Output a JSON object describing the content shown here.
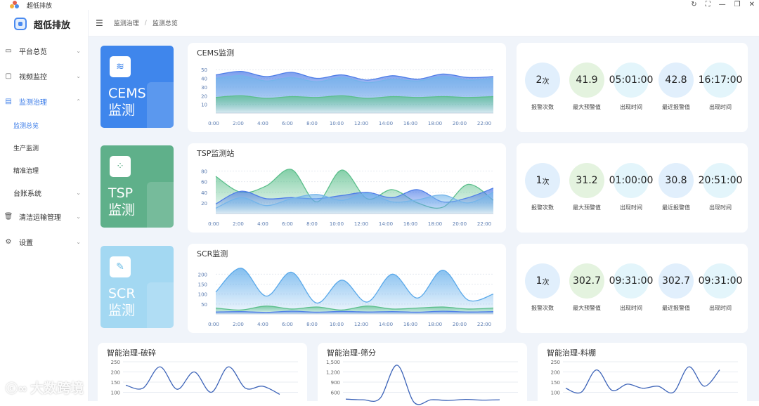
{
  "window": {
    "title": "超低排放"
  },
  "sidebar": {
    "brand": "超低排放",
    "items": [
      {
        "label": "平台总览",
        "icon": "monitor-icon"
      },
      {
        "label": "视频监控",
        "icon": "tv-icon"
      },
      {
        "label": "监测治理",
        "icon": "calendar-icon"
      },
      {
        "label": "清洁运输管理",
        "icon": "trash-icon"
      },
      {
        "label": "设置",
        "icon": "gear-icon"
      }
    ],
    "sub_items": [
      "监测总览",
      "生产监测",
      "精准治理"
    ],
    "sub_group": "台账系统"
  },
  "breadcrumb": [
    "监测治理",
    "监测总览"
  ],
  "rows": [
    {
      "hero": {
        "line1": "CEMS",
        "line2": "监测",
        "color": "#3f86ec"
      },
      "chart_title": "CEMS监测",
      "stats": [
        {
          "value": "2",
          "unit": "次",
          "label": "报警次数"
        },
        {
          "value": "41.9",
          "label": "最大预警值"
        },
        {
          "value": "05:01:00",
          "label": "出现时间"
        },
        {
          "value": "42.8",
          "label": "最近报警值"
        },
        {
          "value": "16:17:00",
          "label": "出现时间"
        }
      ]
    },
    {
      "hero": {
        "line1": "TSP",
        "line2": "监测",
        "color": "#5fb08a"
      },
      "chart_title": "TSP监测站",
      "stats": [
        {
          "value": "1",
          "unit": "次",
          "label": "报警次数"
        },
        {
          "value": "31.2",
          "label": "最大预警值"
        },
        {
          "value": "01:00:00",
          "label": "出现时间"
        },
        {
          "value": "30.8",
          "label": "最近报警值"
        },
        {
          "value": "20:51:00",
          "label": "出现时间"
        }
      ]
    },
    {
      "hero": {
        "line1": "SCR",
        "line2": "监测",
        "color": "#a3d8f2"
      },
      "chart_title": "SCR监测",
      "stats": [
        {
          "value": "1",
          "unit": "次",
          "label": "报警次数"
        },
        {
          "value": "302.7",
          "label": "最大预警值"
        },
        {
          "value": "09:31:00",
          "label": "出现时间"
        },
        {
          "value": "302.7",
          "label": "最近报警值"
        },
        {
          "value": "09:31:00",
          "label": "出现时间"
        }
      ]
    }
  ],
  "bottom_titles": [
    "智能治理-破碎",
    "智能治理-筛分",
    "智能治理-料棚"
  ],
  "watermark": "大数跨境",
  "chart_data": [
    {
      "type": "area",
      "title": "CEMS监测",
      "x": [
        "0:00",
        "2:00",
        "4:00",
        "6:00",
        "8:00",
        "10:00",
        "12:00",
        "14:00",
        "16:00",
        "18:00",
        "20:00",
        "22:00"
      ],
      "yticks": [
        10,
        20,
        30,
        40,
        50
      ],
      "ylim": [
        0,
        55
      ],
      "series": [
        {
          "values": [
            44,
            48,
            42,
            47,
            40,
            44,
            38,
            43,
            39,
            45,
            41,
            42
          ],
          "color": "#4f7ee8"
        },
        {
          "values": [
            40,
            43,
            37,
            41,
            36,
            41,
            35,
            39,
            37,
            42,
            38,
            40
          ],
          "color": "#74b5ea"
        },
        {
          "values": [
            18,
            20,
            17,
            19,
            18,
            20,
            17,
            19,
            18,
            19,
            18,
            19
          ],
          "color": "#5bbf8b"
        }
      ]
    },
    {
      "type": "area",
      "title": "TSP监测站",
      "x": [
        "0:00",
        "2:00",
        "4:00",
        "6:00",
        "8:00",
        "10:00",
        "12:00",
        "14:00",
        "16:00",
        "18:00",
        "20:00",
        "22:00"
      ],
      "yticks": [
        20,
        40,
        60,
        80
      ],
      "ylim": [
        0,
        90
      ],
      "series": [
        {
          "values": [
            70,
            40,
            52,
            83,
            22,
            82,
            28,
            45,
            20,
            12,
            55,
            25
          ],
          "color": "#5bbf8b"
        },
        {
          "values": [
            18,
            42,
            28,
            30,
            28,
            34,
            40,
            30,
            45,
            22,
            30,
            48
          ],
          "color": "#4f7ee8"
        },
        {
          "values": [
            10,
            30,
            15,
            28,
            36,
            25,
            38,
            22,
            26,
            35,
            20,
            40
          ],
          "color": "#74b5ea"
        }
      ]
    },
    {
      "type": "area",
      "title": "SCR监测",
      "x": [
        "0:00",
        "2:00",
        "4:00",
        "6:00",
        "8:00",
        "10:00",
        "12:00",
        "14:00",
        "16:00",
        "18:00",
        "20:00",
        "22:00"
      ],
      "yticks": [
        50,
        100,
        150,
        200
      ],
      "ylim": [
        0,
        240
      ],
      "series": [
        {
          "values": [
            110,
            230,
            90,
            210,
            55,
            170,
            60,
            200,
            80,
            220,
            70,
            100
          ],
          "color": "#5aa9ea"
        },
        {
          "values": [
            30,
            20,
            40,
            25,
            35,
            20,
            40,
            25,
            30,
            35,
            25,
            30
          ],
          "color": "#5bbf8b"
        },
        {
          "values": [
            10,
            12,
            8,
            14,
            9,
            13,
            10,
            12,
            9,
            14,
            10,
            12
          ],
          "color": "#4f7ee8"
        }
      ]
    },
    {
      "type": "line",
      "title": "智能治理-破碎",
      "yticks": [
        100,
        150,
        200,
        250
      ],
      "series": [
        {
          "values": [
            135,
            120,
            225,
            115,
            200,
            100,
            225,
            120,
            130,
            90
          ],
          "color": "#3c63b8"
        }
      ]
    },
    {
      "type": "line",
      "title": "智能治理-筛分",
      "yticks": [
        "600",
        "900",
        "1,200",
        "1,500"
      ],
      "series": [
        {
          "values": [
            400,
            380,
            420,
            1400,
            300,
            380,
            360,
            390,
            370,
            380
          ],
          "color": "#3c63b8"
        }
      ]
    },
    {
      "type": "line",
      "title": "智能治理-料棚",
      "yticks": [
        100,
        150,
        200,
        250
      ],
      "series": [
        {
          "values": [
            120,
            100,
            210,
            110,
            140,
            120,
            130,
            100,
            225,
            130,
            210
          ],
          "color": "#3c63b8"
        }
      ]
    }
  ]
}
